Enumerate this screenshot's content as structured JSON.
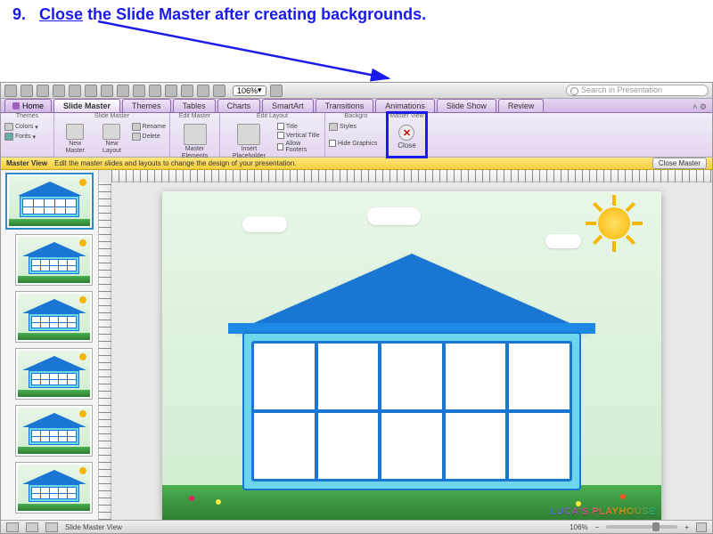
{
  "instruction": {
    "number": "9.",
    "keyword": "Close",
    "rest": " the Slide Master after creating backgrounds."
  },
  "toolbar": {
    "zoom": "106%",
    "search_placeholder": "Search in Presentation"
  },
  "ribbon": {
    "home_label": "Home",
    "tabs": [
      "Slide Master",
      "Themes",
      "Tables",
      "Charts",
      "SmartArt",
      "Transitions",
      "Animations",
      "Slide Show",
      "Review"
    ],
    "active_tab": 0,
    "groups": {
      "themes": {
        "label": "Themes",
        "colors": "Colors",
        "fonts": "Fonts"
      },
      "slide_master": {
        "label": "Slide Master",
        "new_master": "New Master",
        "new_layout": "New Layout",
        "rename": "Rename",
        "delete": "Delete"
      },
      "edit_master": {
        "label": "Edit Master",
        "master_elements": "Master Elements"
      },
      "edit_layout": {
        "label": "Edit Layout",
        "insert_placeholder": "Insert\nPlaceholder",
        "title": "Title",
        "vertical_title": "Vertical Title",
        "allow_footers": "Allow Footers"
      },
      "background": {
        "label": "Backgro",
        "styles": "Styles",
        "hide_graphics": "Hide Graphics"
      },
      "master_view": {
        "label": "Master View",
        "close": "Close"
      }
    }
  },
  "infobar": {
    "title": "Master View",
    "text": "Edit the master slides and layouts to change the design of your presentation.",
    "close": "Close Master"
  },
  "statusbar": {
    "mode": "Slide Master View",
    "zoom": "106%"
  },
  "slide": {
    "brand": "LUCA'S PLAYHOUSE"
  }
}
